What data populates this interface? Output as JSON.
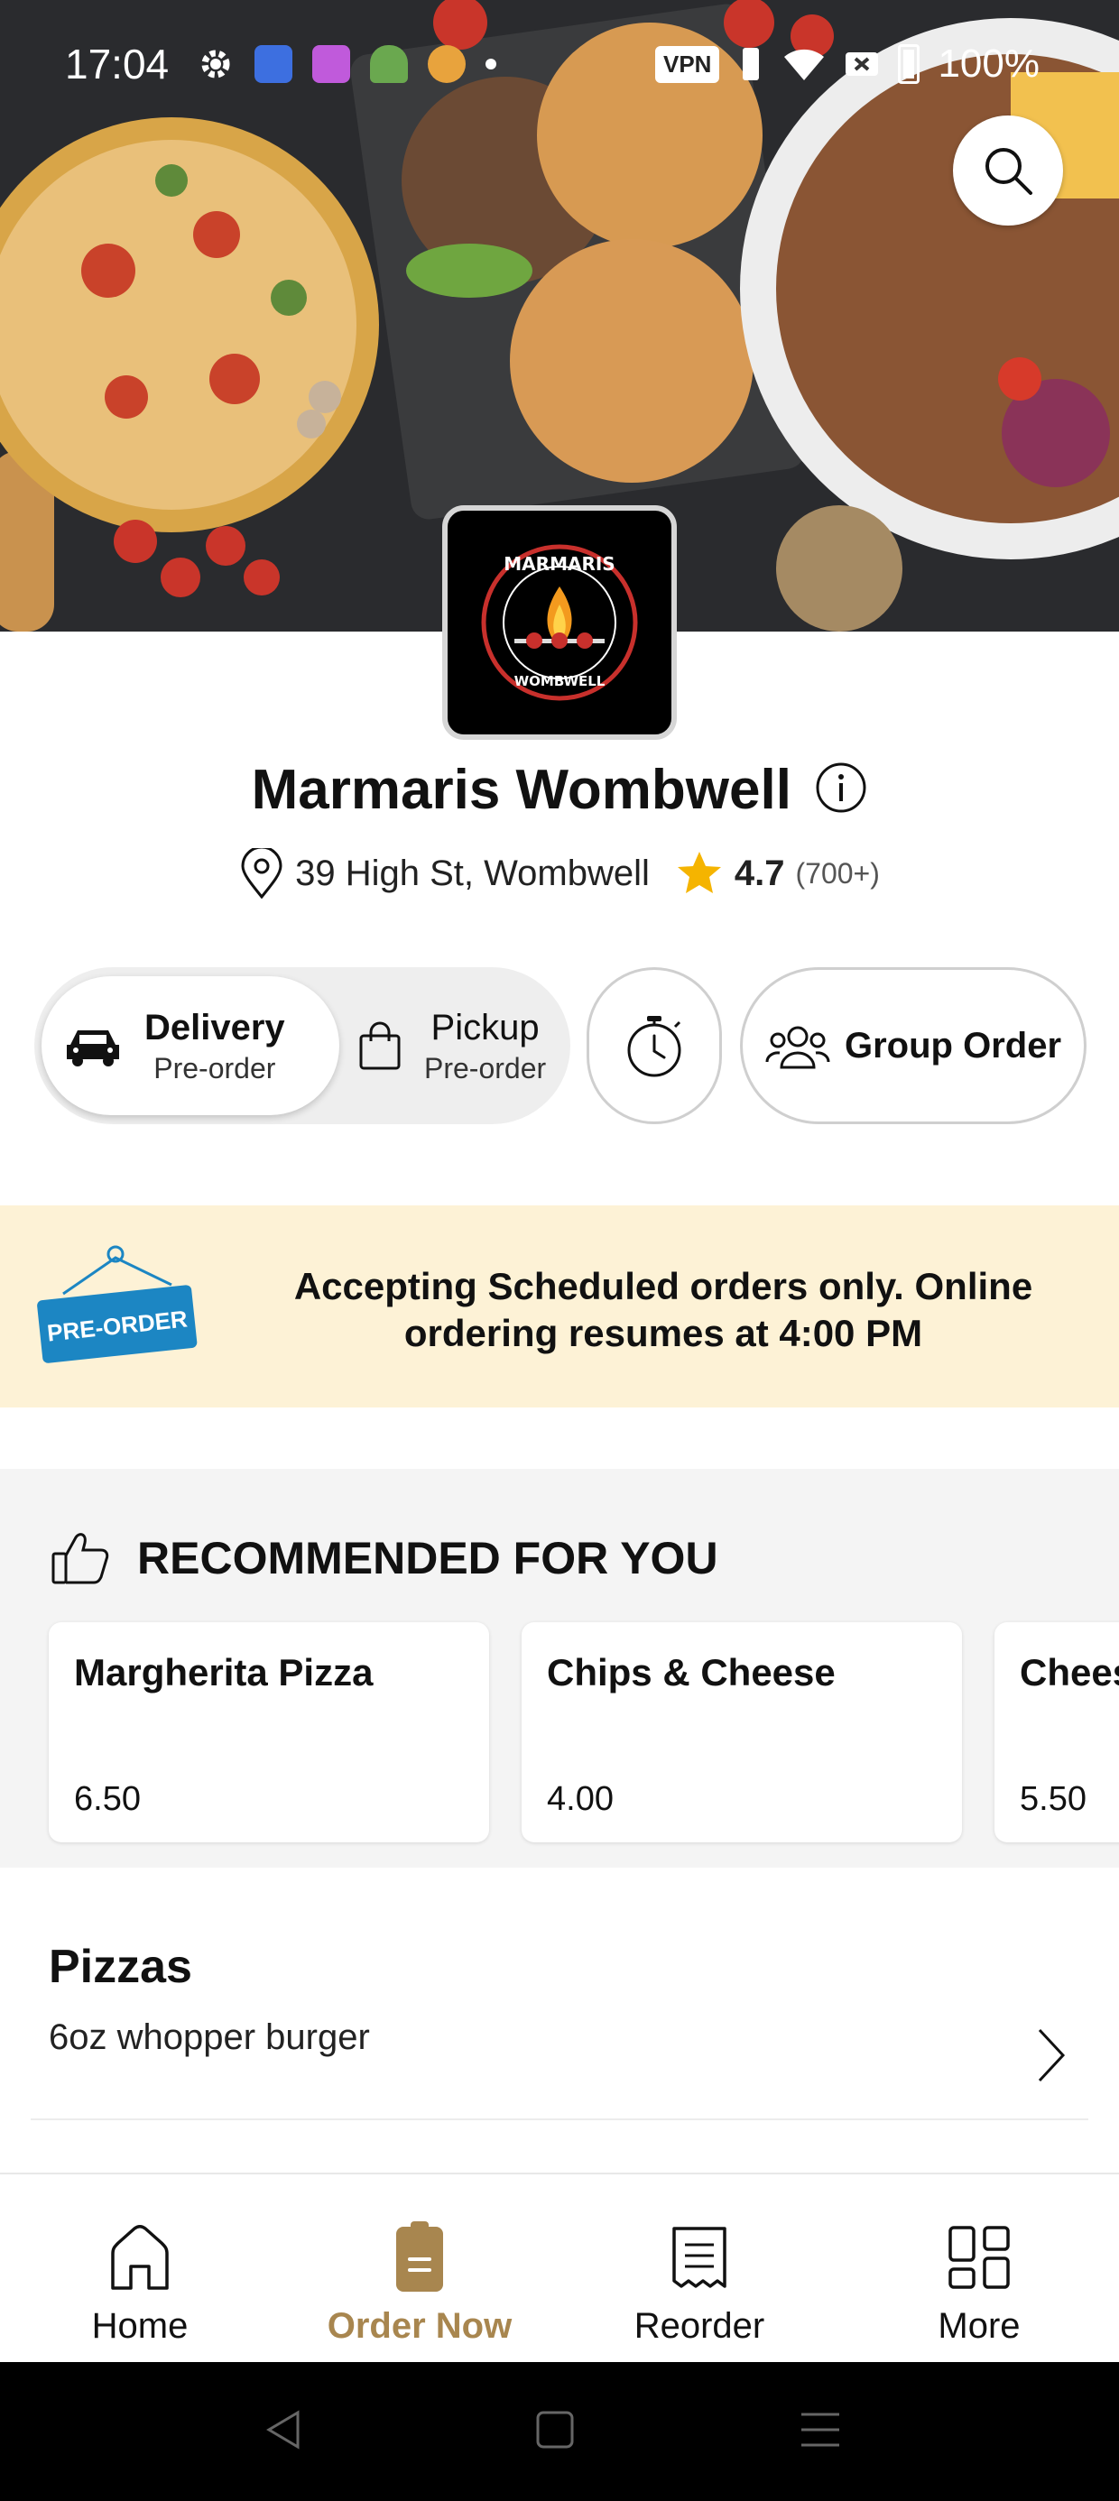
{
  "status_bar": {
    "time": "17:04",
    "vpn": "VPN",
    "battery": "100%"
  },
  "restaurant": {
    "logo_text_top": "MARMARIS",
    "logo_text_bottom": "WOMBWELL",
    "name": "Marmaris Wombwell",
    "address": "39 High St, Wombwell",
    "rating": "4.7",
    "rating_count": "(700+)"
  },
  "order_mode": {
    "delivery": {
      "label": "Delivery",
      "sub": "Pre-order",
      "selected": true
    },
    "pickup": {
      "label": "Pickup",
      "sub": "Pre-order",
      "selected": false
    },
    "group_order": "Group Order"
  },
  "banner": {
    "tag": "PRE-ORDER",
    "message": "Accepting Scheduled orders only. Online ordering resumes at 4:00 PM"
  },
  "recommended": {
    "title": "RECOMMENDED FOR YOU",
    "items": [
      {
        "name": "Margherita Pizza",
        "price": "6.50"
      },
      {
        "name": "Chips & Cheese",
        "price": "4.00"
      },
      {
        "name": "Chees",
        "price": "5.50"
      }
    ]
  },
  "categories": [
    {
      "name": "Pizzas",
      "description": "6oz whopper burger"
    }
  ],
  "bottom_nav": {
    "items": [
      {
        "label": "Home",
        "icon": "home-icon",
        "active": false
      },
      {
        "label": "Order Now",
        "icon": "order-icon",
        "active": true
      },
      {
        "label": "Reorder",
        "icon": "receipt-icon",
        "active": false
      },
      {
        "label": "More",
        "icon": "grid-icon",
        "active": false
      }
    ]
  },
  "colors": {
    "accent": "#a8864f",
    "banner_bg": "#fdf2d6",
    "star": "#f5b400",
    "preorder_tag": "#1c86c3"
  }
}
